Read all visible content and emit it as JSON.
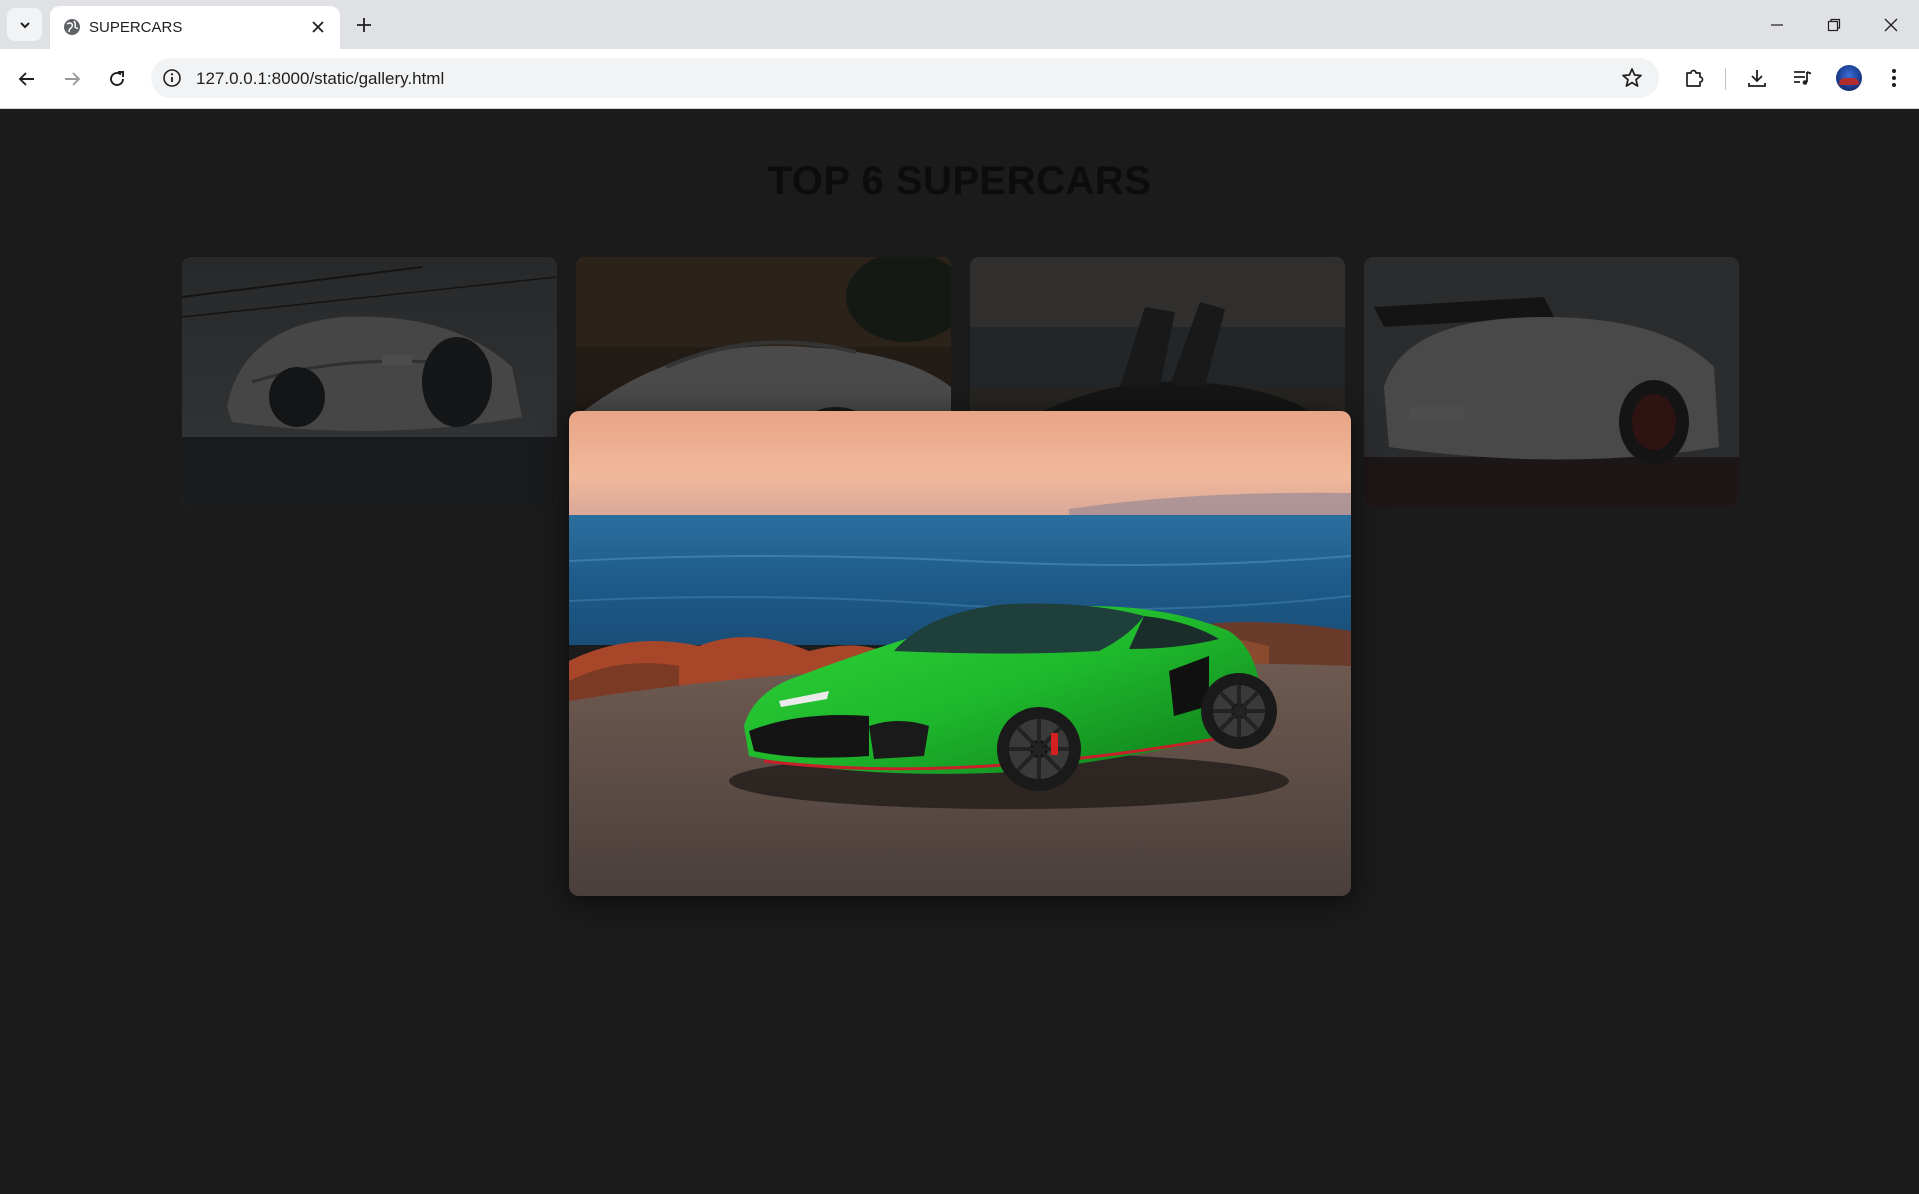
{
  "browser": {
    "tab_title": "SUPERCARS",
    "url": "127.0.0.1:8000/static/gallery.html"
  },
  "page": {
    "title": "TOP 6 SUPERCARS"
  },
  "gallery": {
    "thumbnails": [
      {
        "subject": "white Bugatti Chiron"
      },
      {
        "subject": "white supercar"
      },
      {
        "subject": "supercar with scissor doors by the sea"
      },
      {
        "subject": "white Porsche GT3 RS"
      }
    ],
    "lightbox": {
      "subject": "green Lamborghini Temerario by the ocean at sunset"
    }
  },
  "colors": {
    "page_background": "#1b1b1b",
    "title_color": "#0c0c0c",
    "car_green": "#1fb82c"
  }
}
